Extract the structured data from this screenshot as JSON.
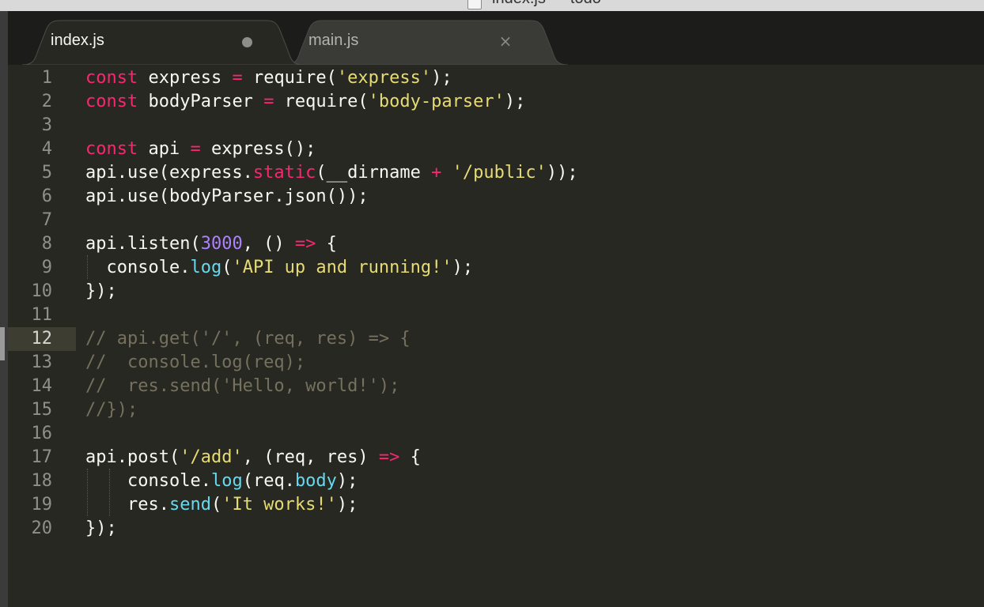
{
  "window": {
    "title": "index.js — todo"
  },
  "tabs": [
    {
      "label": "index.js",
      "active": true,
      "indicator": "dirty-dot-icon"
    },
    {
      "label": "main.js",
      "active": false,
      "indicator": "close-icon",
      "close_glyph": "×"
    }
  ],
  "colors": {
    "background": "#272822",
    "keyword": "#f92672",
    "string": "#e6db74",
    "number": "#ae81ff",
    "function": "#66d9ef",
    "comment": "#75715e",
    "text": "#f8f8f2"
  },
  "editor": {
    "active_line": 12,
    "lines": [
      {
        "num": "1",
        "tokens": [
          [
            "kw",
            "const"
          ],
          [
            "plain",
            " express "
          ],
          [
            "op",
            "="
          ],
          [
            "plain",
            " require("
          ],
          [
            "str",
            "'express'"
          ],
          [
            "plain",
            ");"
          ]
        ]
      },
      {
        "num": "2",
        "tokens": [
          [
            "kw",
            "const"
          ],
          [
            "plain",
            " bodyParser "
          ],
          [
            "op",
            "="
          ],
          [
            "plain",
            " require("
          ],
          [
            "str",
            "'body-parser'"
          ],
          [
            "plain",
            ");"
          ]
        ]
      },
      {
        "num": "3",
        "tokens": []
      },
      {
        "num": "4",
        "tokens": [
          [
            "kw",
            "const"
          ],
          [
            "plain",
            " api "
          ],
          [
            "op",
            "="
          ],
          [
            "plain",
            " express();"
          ]
        ]
      },
      {
        "num": "5",
        "tokens": [
          [
            "plain",
            "api.use(express."
          ],
          [
            "kw",
            "static"
          ],
          [
            "plain",
            "(__dirname "
          ],
          [
            "op",
            "+"
          ],
          [
            "plain",
            " "
          ],
          [
            "str",
            "'/public'"
          ],
          [
            "plain",
            "));"
          ]
        ]
      },
      {
        "num": "6",
        "tokens": [
          [
            "plain",
            "api.use(bodyParser.json());"
          ]
        ]
      },
      {
        "num": "7",
        "tokens": []
      },
      {
        "num": "8",
        "tokens": [
          [
            "plain",
            "api.listen("
          ],
          [
            "num",
            "3000"
          ],
          [
            "plain",
            ", () "
          ],
          [
            "op",
            "=>"
          ],
          [
            "plain",
            " {"
          ]
        ]
      },
      {
        "num": "9",
        "tokens": [
          [
            "plain",
            "  console."
          ],
          [
            "fn",
            "log"
          ],
          [
            "plain",
            "("
          ],
          [
            "str",
            "'API up and running!'"
          ],
          [
            "plain",
            ");"
          ]
        ]
      },
      {
        "num": "10",
        "tokens": [
          [
            "plain",
            "});"
          ]
        ]
      },
      {
        "num": "11",
        "tokens": []
      },
      {
        "num": "12",
        "tokens": [
          [
            "cm",
            "// api.get('/', (req, res) => {"
          ]
        ]
      },
      {
        "num": "13",
        "tokens": [
          [
            "cm",
            "//  console.log(req);"
          ]
        ]
      },
      {
        "num": "14",
        "tokens": [
          [
            "cm",
            "//  res.send('Hello, world!');"
          ]
        ]
      },
      {
        "num": "15",
        "tokens": [
          [
            "cm",
            "//});"
          ]
        ]
      },
      {
        "num": "16",
        "tokens": []
      },
      {
        "num": "17",
        "tokens": [
          [
            "plain",
            "api.post("
          ],
          [
            "str",
            "'/add'"
          ],
          [
            "plain",
            ", (req, res) "
          ],
          [
            "op",
            "=>"
          ],
          [
            "plain",
            " {"
          ]
        ]
      },
      {
        "num": "18",
        "tokens": [
          [
            "plain",
            "    console."
          ],
          [
            "fn",
            "log"
          ],
          [
            "plain",
            "(req."
          ],
          [
            "fn",
            "body"
          ],
          [
            "plain",
            ");"
          ]
        ]
      },
      {
        "num": "19",
        "tokens": [
          [
            "plain",
            "    res."
          ],
          [
            "fn",
            "send"
          ],
          [
            "plain",
            "("
          ],
          [
            "str",
            "'It works!'"
          ],
          [
            "plain",
            ");"
          ]
        ]
      },
      {
        "num": "20",
        "tokens": [
          [
            "plain",
            "});"
          ]
        ]
      }
    ]
  }
}
